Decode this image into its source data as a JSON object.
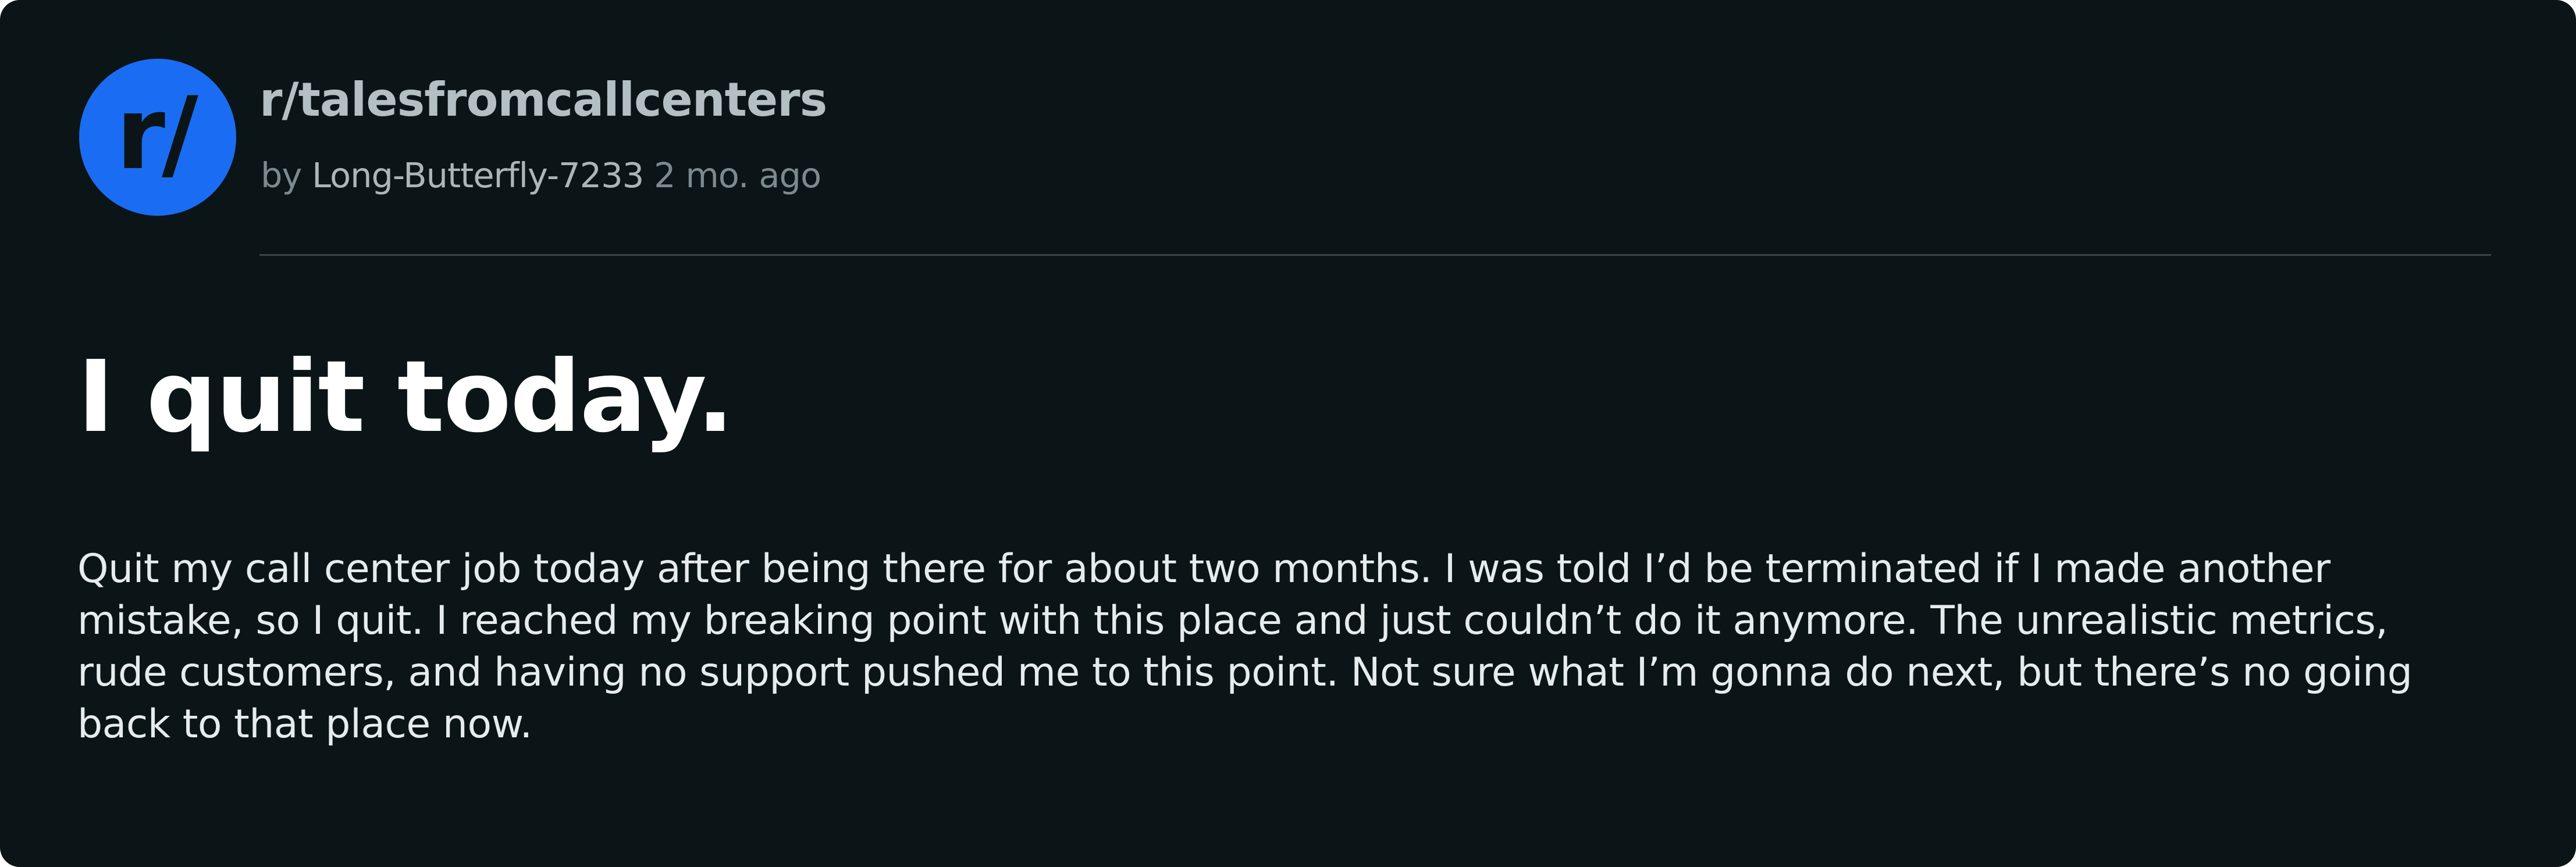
{
  "post": {
    "avatar_text": "r/",
    "subreddit": "r/talesfromcallcenters",
    "by_label": "by",
    "author": "Long-Butterfly-7233",
    "age": "2 mo. ago",
    "title": "I quit today.",
    "body_lines": [
      "Quit my call center job today after being there for about two months. I was told I’d be terminated if I made another",
      "mistake, so I quit. I reached my breaking point with this place and just couldn’t do it anymore. The unrealistic metrics,",
      "rude customers, and having no support pushed me to this point. Not sure what I’m gonna do next, but there’s no going",
      "back to that place now."
    ]
  },
  "colors": {
    "background": "#0b1416",
    "avatar": "#1a6df2",
    "title": "#ffffff",
    "body_text": "#e6eced",
    "muted": "#7c8a8f"
  }
}
